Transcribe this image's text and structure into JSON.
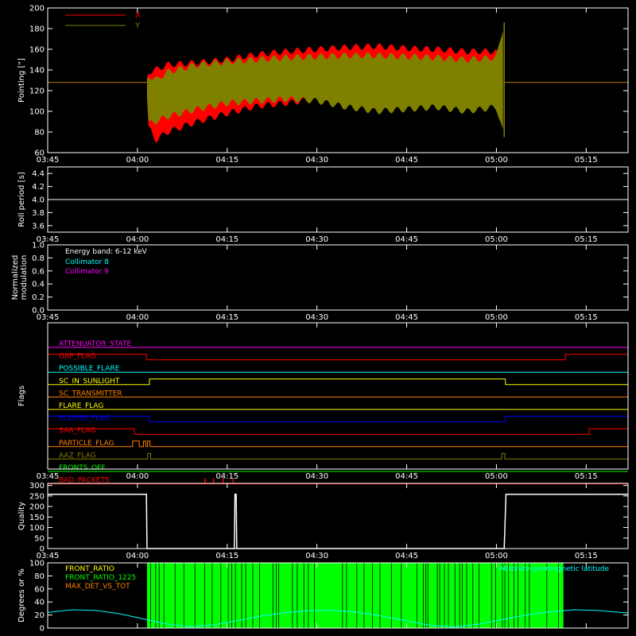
{
  "time_axis": {
    "ticks": [
      "03:45",
      "04:00",
      "04:15",
      "04:30",
      "04:45",
      "05:00",
      "05:15"
    ],
    "tick_minutes": [
      0,
      15,
      30,
      45,
      60,
      75,
      90
    ],
    "range_minutes": [
      0,
      97
    ]
  },
  "colors": {
    "x_series": "#ff0000",
    "y_series": "#808000",
    "collimator_8": "#00ffff",
    "collimator_9": "#ff00ff",
    "front_ratio_1225": "#00ff00",
    "geomag": "#00ffff"
  },
  "chart_data": [
    {
      "type": "line",
      "ylabel": "Pointing [\"]",
      "ylim": [
        60,
        200
      ],
      "yticks": [
        60,
        80,
        100,
        120,
        140,
        160,
        180,
        200
      ],
      "legend_placement": "top-left",
      "series": [
        {
          "name": "X",
          "color": "#ff0000",
          "envelope_x": [
            0,
            16.5,
            16.8,
            18,
            20,
            25,
            30,
            35,
            40,
            45,
            50,
            55,
            60,
            65,
            70,
            75,
            76.5,
            97
          ],
          "upper": [
            128,
            128,
            138,
            140,
            145,
            147,
            150,
            155,
            158,
            160,
            162,
            163,
            161,
            160,
            158,
            158,
            128,
            128
          ],
          "lower": [
            128,
            128,
            85,
            72,
            80,
            90,
            98,
            105,
            108,
            112,
            114,
            113,
            111,
            112,
            108,
            110,
            128,
            128
          ]
        },
        {
          "name": "Y",
          "color": "#808000",
          "envelope_x": [
            0,
            16.5,
            16.8,
            18,
            20,
            25,
            30,
            35,
            40,
            45,
            50,
            55,
            60,
            65,
            70,
            75,
            76.3,
            76.5,
            97
          ],
          "upper": [
            128,
            128,
            135,
            130,
            138,
            145,
            148,
            150,
            152,
            153,
            154,
            154,
            153,
            152,
            150,
            152,
            186,
            128,
            128
          ],
          "lower": [
            128,
            128,
            88,
            90,
            95,
            102,
            108,
            110,
            112,
            110,
            104,
            100,
            102,
            104,
            100,
            104,
            75,
            128,
            128
          ]
        }
      ]
    },
    {
      "type": "line",
      "ylabel": "Roll period [s]",
      "ylim": [
        3.5,
        4.5
      ],
      "yticks": [
        3.6,
        3.8,
        4.0,
        4.2,
        4.4
      ],
      "series": [
        {
          "x": [
            0,
            97
          ],
          "y": [
            4.0,
            4.0
          ],
          "color": "#ffffff"
        }
      ]
    },
    {
      "type": "line",
      "ylabel": [
        "Normalized",
        "modulation"
      ],
      "ylim": [
        0,
        1
      ],
      "yticks": [
        0.0,
        0.2,
        0.4,
        0.6,
        0.8,
        1.0
      ],
      "annotation": "Energy band: 6-12 keV",
      "series": [
        {
          "name": "Collimator 8",
          "color": "#00ffff",
          "x": [
            0,
            97
          ],
          "y": [
            0,
            0
          ]
        },
        {
          "name": "Collimator 9",
          "color": "#ff00ff",
          "x": [
            0,
            97
          ],
          "y": [
            0,
            0
          ]
        }
      ]
    },
    {
      "type": "line",
      "ylabel": "Flags",
      "flags": [
        {
          "name": "ATTENUATOR_STATE",
          "color": "#ff00ff",
          "steps": []
        },
        {
          "name": "GAP_FLAG",
          "color": "#ff0000",
          "steps": [
            [
              0,
              1
            ],
            [
              16.5,
              0
            ],
            [
              86.5,
              1
            ]
          ]
        },
        {
          "name": "POSSIBLE_FLARE",
          "color": "#00ffff",
          "steps": []
        },
        {
          "name": "SC_IN_SUNLIGHT",
          "color": "#ffff00",
          "steps": [
            [
              0,
              0
            ],
            [
              17,
              1
            ],
            [
              76.5,
              0
            ]
          ]
        },
        {
          "name": "SC_TRANSMITTER",
          "color": "#ff8000",
          "steps": []
        },
        {
          "name": "FLARE_FLAG",
          "color": "#ffff00",
          "steps": []
        },
        {
          "name": "ECLIPSE_FLAG",
          "color": "#0000ff",
          "steps": [
            [
              0,
              1
            ],
            [
              17,
              0
            ],
            [
              76.5,
              1
            ]
          ]
        },
        {
          "name": "SAA_FLAG",
          "color": "#ff0000",
          "steps": [
            [
              0,
              1
            ],
            [
              14.5,
              0
            ],
            [
              90.5,
              1
            ]
          ]
        },
        {
          "name": "PARTICLE_FLAG",
          "color": "#ff8000",
          "steps": [
            [
              0,
              0
            ],
            [
              14.2,
              1
            ],
            [
              15.3,
              0
            ],
            [
              16,
              1
            ],
            [
              16.4,
              0
            ],
            [
              16.7,
              1
            ],
            [
              17.1,
              0
            ]
          ]
        },
        {
          "name": "AAZ_FLAG",
          "color": "#808000",
          "steps": [
            [
              0,
              0
            ],
            [
              16.7,
              1
            ],
            [
              17.2,
              0
            ],
            [
              75.9,
              1
            ],
            [
              76.4,
              0
            ]
          ]
        },
        {
          "name": "FRONTS_OFF",
          "color": "#00ff00",
          "steps": []
        },
        {
          "name": "BAD_PACKETS",
          "color": "#ff0000",
          "spikes": [
            26.3,
            27.7,
            29.3,
            31
          ]
        }
      ]
    },
    {
      "type": "line",
      "ylabel": "Quality",
      "ylim": [
        0,
        310
      ],
      "yticks": [
        0,
        50,
        100,
        150,
        200,
        250,
        300
      ],
      "series": [
        {
          "color": "#ffffff",
          "x": [
            0,
            16.5,
            16.6,
            31.2,
            31.3,
            31.5,
            31.6,
            76.3,
            76.6,
            97
          ],
          "y": [
            258,
            258,
            0,
            0,
            258,
            258,
            0,
            0,
            258,
            258
          ]
        }
      ]
    },
    {
      "type": "bar",
      "ylabel": "Degrees or %",
      "ylim": [
        0,
        100
      ],
      "yticks": [
        0,
        20,
        40,
        60,
        80,
        100
      ],
      "legend": [
        {
          "name": "FRONT_RATIO",
          "color": "#ffff00"
        },
        {
          "name": "FRONT_RATIO_1225",
          "color": "#00ff00"
        },
        {
          "name": "MAX_DET_VS_TOT",
          "color": "#ff8000"
        }
      ],
      "annotation": "Absolute geomagnetic latitude",
      "fill_range": [
        16.6,
        86.2
      ],
      "fill_value": 100,
      "geomag_series": {
        "name": "Absolute geomagnetic latitude",
        "color": "#00ffff",
        "x": [
          0,
          4,
          8,
          12,
          16,
          20,
          24,
          28,
          32,
          36,
          40,
          44,
          48,
          52,
          56,
          60,
          64,
          68,
          72,
          76,
          80,
          84,
          88,
          92,
          97
        ],
        "y": [
          24,
          28,
          27,
          22,
          14,
          6,
          2,
          5,
          12,
          19,
          24,
          27,
          27,
          24,
          18,
          11,
          4,
          2,
          6,
          13,
          20,
          25,
          28,
          27,
          23
        ]
      }
    }
  ]
}
